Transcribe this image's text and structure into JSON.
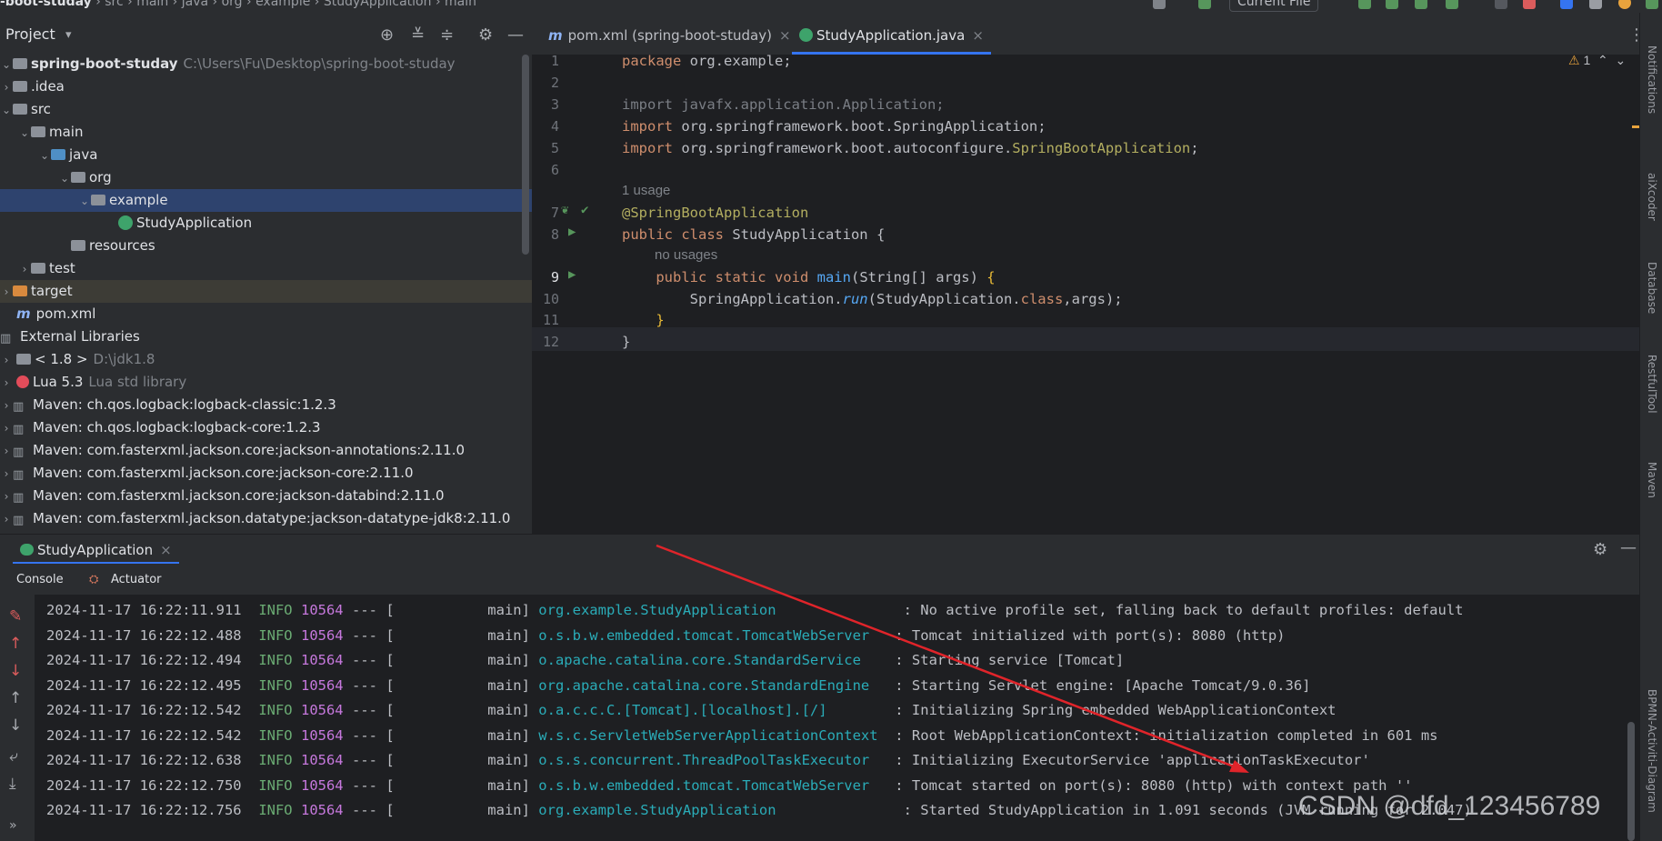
{
  "navbar": {
    "crumbs": [
      "-boot-studay",
      "src",
      "main",
      "java",
      "org",
      "example",
      "StudyApplication",
      "main"
    ],
    "run_config": "Current File"
  },
  "project": {
    "title": "Project",
    "root_name": "spring-boot-studay",
    "root_path": "C:\\Users\\Fu\\Desktop\\spring-boot-studay",
    "items": [
      {
        "label": ".idea",
        "sub": ""
      },
      {
        "label": "src",
        "sub": ""
      },
      {
        "label": "main",
        "sub": ""
      },
      {
        "label": "java",
        "sub": ""
      },
      {
        "label": "org",
        "sub": ""
      },
      {
        "label": "example",
        "sub": ""
      },
      {
        "label": "StudyApplication",
        "sub": ""
      },
      {
        "label": "resources",
        "sub": ""
      },
      {
        "label": "test",
        "sub": ""
      },
      {
        "label": "target",
        "sub": ""
      },
      {
        "label": "pom.xml",
        "sub": ""
      },
      {
        "label": "External Libraries",
        "sub": ""
      },
      {
        "label": "< 1.8 >",
        "sub": "D:\\jdk1.8"
      },
      {
        "label": "Lua 5.3",
        "sub": "Lua std library"
      },
      {
        "label": "Maven: ch.qos.logback:logback-classic:1.2.3",
        "sub": ""
      },
      {
        "label": "Maven: ch.qos.logback:logback-core:1.2.3",
        "sub": ""
      },
      {
        "label": "Maven: com.fasterxml.jackson.core:jackson-annotations:2.11.0",
        "sub": ""
      },
      {
        "label": "Maven: com.fasterxml.jackson.core:jackson-core:2.11.0",
        "sub": ""
      },
      {
        "label": "Maven: com.fasterxml.jackson.core:jackson-databind:2.11.0",
        "sub": ""
      },
      {
        "label": "Maven: com.fasterxml.jackson.datatype:jackson-datatype-jdk8:2.11.0",
        "sub": ""
      }
    ]
  },
  "tabs": [
    {
      "label": "pom.xml (spring-boot-studay)"
    },
    {
      "label": "StudyApplication.java"
    }
  ],
  "editor": {
    "warning_count": "1",
    "usage_hint": "1 usage",
    "no_usage_hint": "no usages",
    "line_numbers": [
      "1",
      "2",
      "3",
      "4",
      "5",
      "6",
      "7",
      "8",
      "9",
      "10",
      "11",
      "12"
    ],
    "lines": {
      "l1a": "package",
      "l1b": " org.example;",
      "l3": "import javafx.application.Application;",
      "l4a": "import",
      "l4b": " org.springframework.boot.SpringApplication;",
      "l5a": "import",
      "l5b": " org.springframework.boot.autoconfigure.",
      "l5c": "SpringBootApplication",
      "l5d": ";",
      "l7": "@SpringBootApplication",
      "l8a": "public class",
      "l8b": " StudyApplication {",
      "l9a": "    public static void",
      "l9b": " main",
      "l9c": "(String[] args) ",
      "l9d": "{",
      "l10a": "        SpringApplication.",
      "l10b": "run",
      "l10c": "(StudyApplication.",
      "l10d": "class",
      "l10e": ",args);",
      "l11": "    }",
      "l12": "}"
    }
  },
  "side_labels": [
    "Notifications",
    "aiXcoder",
    "Database",
    "RestfulTool",
    "Maven",
    "BPMN-Activiti-Diagram"
  ],
  "run": {
    "tab_label": "StudyApplication",
    "console_tab": "Console",
    "actuator_tab": "Actuator",
    "logs": [
      {
        "ts": "2024-11-17 16:22:11.911",
        "level": "INFO",
        "pid": "10564",
        "thread": "main",
        "logger": "org.example.StudyApplication              ",
        "msg": ": No active profile set, falling back to default profiles: default"
      },
      {
        "ts": "2024-11-17 16:22:12.488",
        "level": "INFO",
        "pid": "10564",
        "thread": "main",
        "logger": "o.s.b.w.embedded.tomcat.TomcatWebServer  ",
        "msg": ": Tomcat initialized with port(s): 8080 (http)"
      },
      {
        "ts": "2024-11-17 16:22:12.494",
        "level": "INFO",
        "pid": "10564",
        "thread": "main",
        "logger": "o.apache.catalina.core.StandardService   ",
        "msg": ": Starting service [Tomcat]"
      },
      {
        "ts": "2024-11-17 16:22:12.495",
        "level": "INFO",
        "pid": "10564",
        "thread": "main",
        "logger": "org.apache.catalina.core.StandardEngine  ",
        "msg": ": Starting Servlet engine: [Apache Tomcat/9.0.36]"
      },
      {
        "ts": "2024-11-17 16:22:12.542",
        "level": "INFO",
        "pid": "10564",
        "thread": "main",
        "logger": "o.a.c.c.C.[Tomcat].[localhost].[/]       ",
        "msg": ": Initializing Spring embedded WebApplicationContext"
      },
      {
        "ts": "2024-11-17 16:22:12.542",
        "level": "INFO",
        "pid": "10564",
        "thread": "main",
        "logger": "w.s.c.ServletWebServerApplicationContext ",
        "msg": ": Root WebApplicationContext: initialization completed in 601 ms"
      },
      {
        "ts": "2024-11-17 16:22:12.638",
        "level": "INFO",
        "pid": "10564",
        "thread": "main",
        "logger": "o.s.s.concurrent.ThreadPoolTaskExecutor  ",
        "msg": ": Initializing ExecutorService 'applicationTaskExecutor'"
      },
      {
        "ts": "2024-11-17 16:22:12.750",
        "level": "INFO",
        "pid": "10564",
        "thread": "main",
        "logger": "o.s.b.w.embedded.tomcat.TomcatWebServer  ",
        "msg": ": Tomcat started on port(s): 8080 (http) with context path ''"
      },
      {
        "ts": "2024-11-17 16:22:12.756",
        "level": "INFO",
        "pid": "10564",
        "thread": "main",
        "logger": "org.example.StudyApplication              ",
        "msg": ": Started StudyApplication in 1.091 seconds (JVM running for 2.047)"
      }
    ]
  },
  "watermark": "CSDN @dfd_123456789",
  "colors": {
    "accent": "#3574f0",
    "selection": "#2e436e",
    "arrow": "#e0242a"
  }
}
